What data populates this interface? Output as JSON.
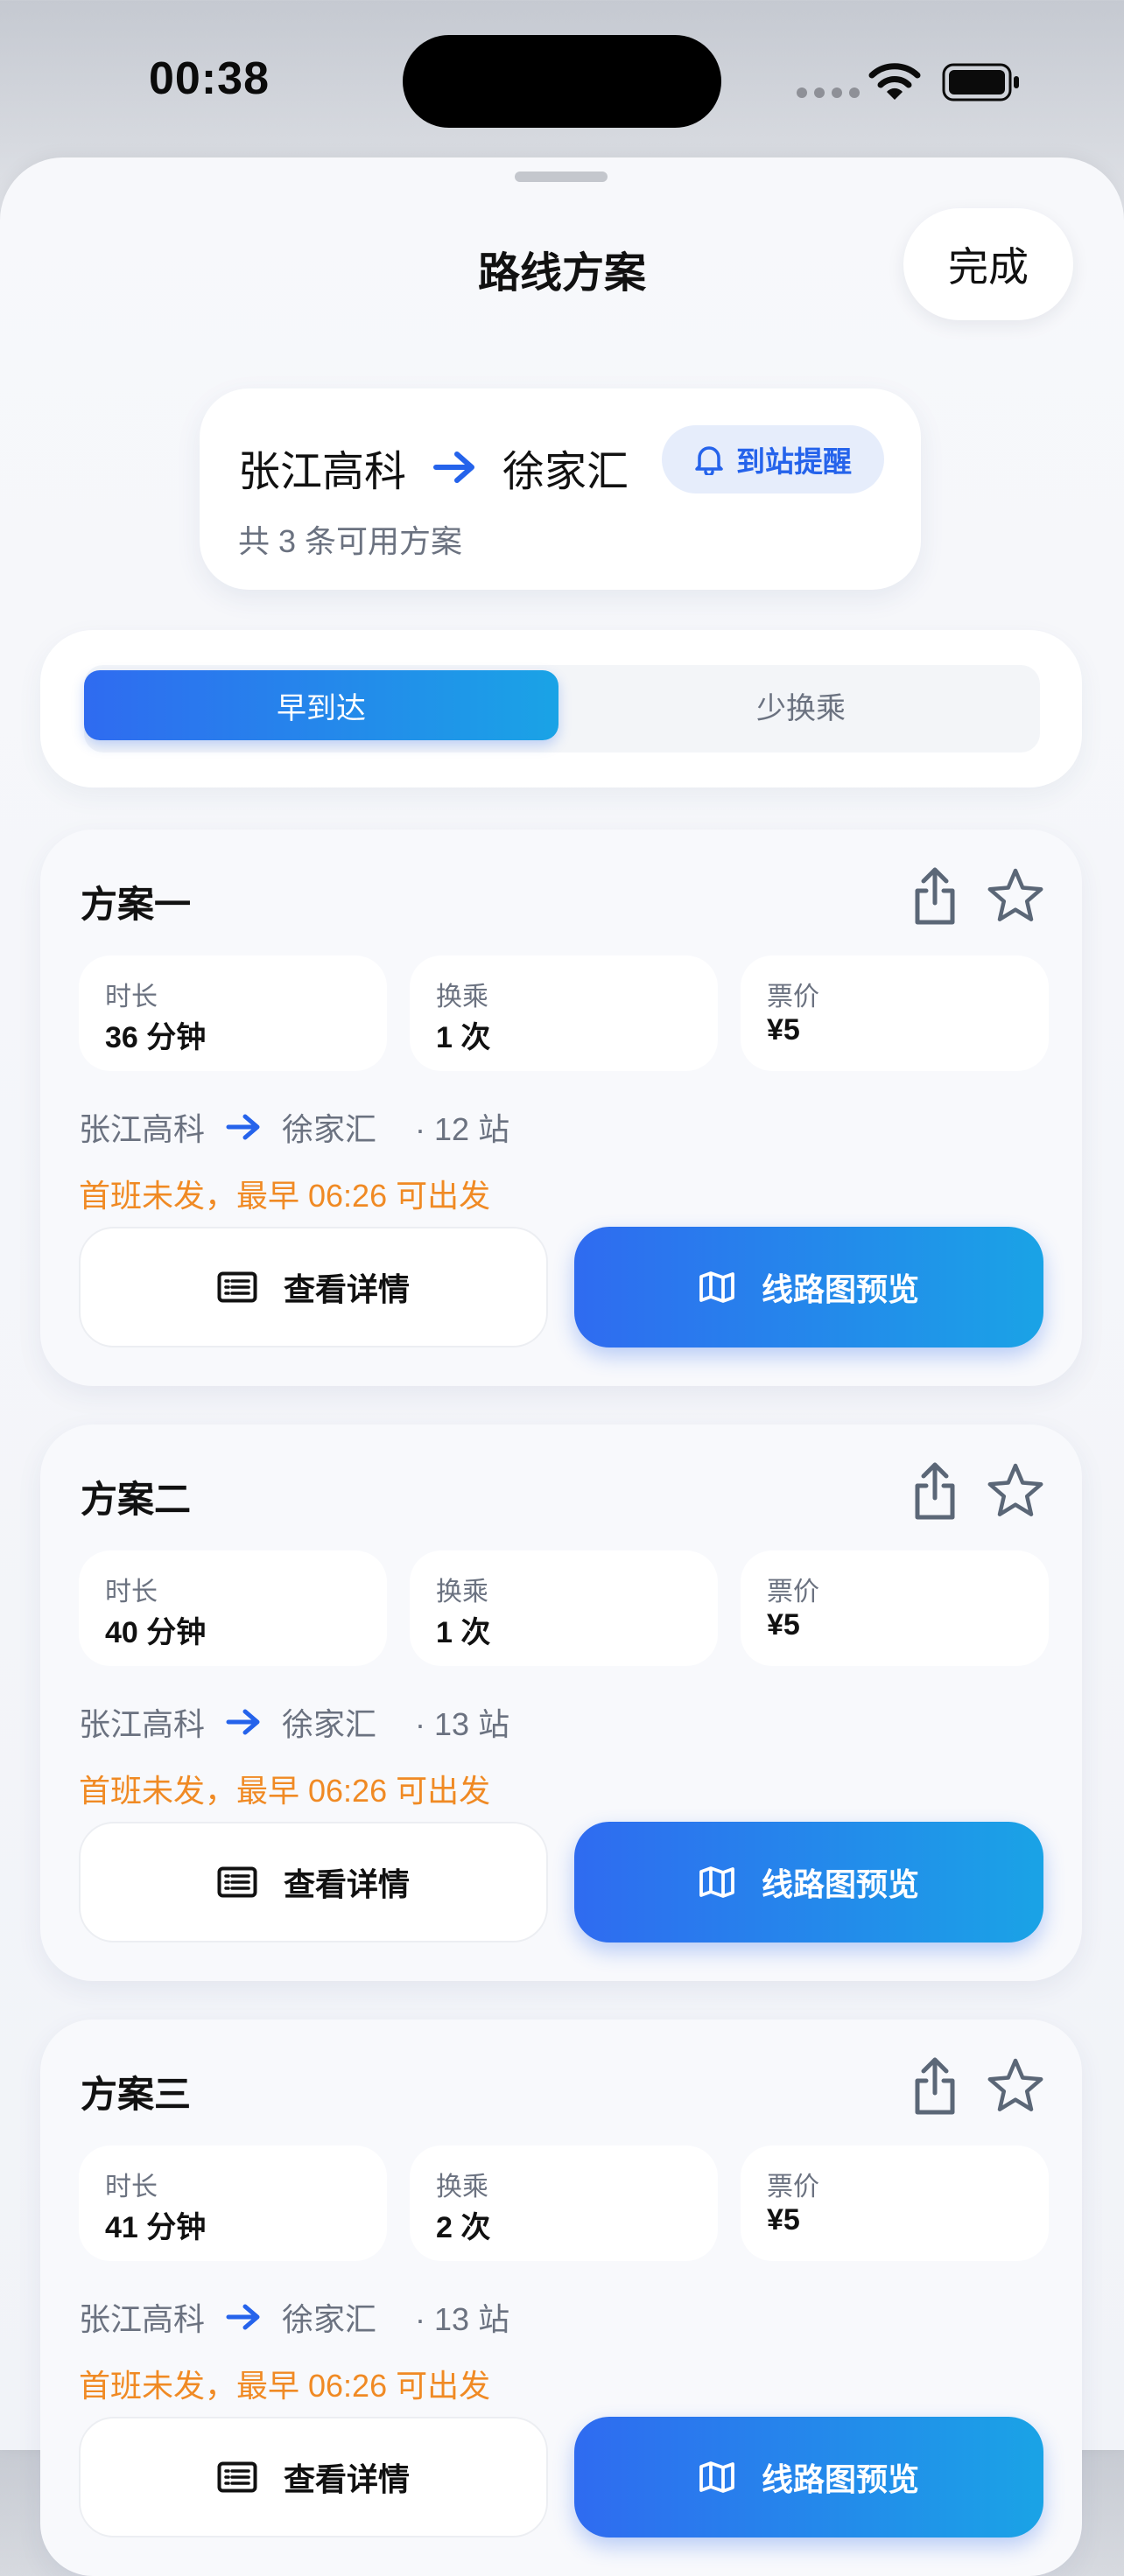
{
  "status_bar": {
    "time": "00:38"
  },
  "sheet": {
    "title": "路线方案",
    "done_label": "完成"
  },
  "route_summary": {
    "from": "张江高科",
    "to": "徐家汇",
    "reminder_label": "到站提醒",
    "subtitle": "共 3 条可用方案"
  },
  "segment": {
    "options": [
      "早到达",
      "少换乘"
    ],
    "selected": "早到达"
  },
  "plans": [
    {
      "title": "方案一",
      "stats": [
        {
          "label": "时长",
          "value": "36 分钟"
        },
        {
          "label": "换乘",
          "value": "1 次"
        },
        {
          "label": "票价",
          "value": "¥5"
        }
      ],
      "from": "张江高科",
      "to": "徐家汇",
      "stops": "· 12 站",
      "note": "首班未发，最早 06:26 可出发",
      "detail_label": "查看详情",
      "map_label": "线路图预览"
    },
    {
      "title": "方案二",
      "stats": [
        {
          "label": "时长",
          "value": "40 分钟"
        },
        {
          "label": "换乘",
          "value": "1 次"
        },
        {
          "label": "票价",
          "value": "¥5"
        }
      ],
      "from": "张江高科",
      "to": "徐家汇",
      "stops": "· 13 站",
      "note": "首班未发，最早 06:26 可出发",
      "detail_label": "查看详情",
      "map_label": "线路图预览"
    },
    {
      "title": "方案三",
      "stats": [
        {
          "label": "时长",
          "value": "41 分钟"
        },
        {
          "label": "换乘",
          "value": "2 次"
        },
        {
          "label": "票价",
          "value": "¥5"
        }
      ],
      "from": "张江高科",
      "to": "徐家汇",
      "stops": "· 13 站",
      "note": "首班未发，最早 06:26 可出发",
      "detail_label": "查看详情",
      "map_label": "线路图预览"
    }
  ],
  "icons": {
    "route_arrow": "arrow-right-icon",
    "reminder": "bell-icon",
    "share": "share-icon",
    "favorite": "star-icon",
    "detail": "list-icon",
    "map": "map-icon"
  },
  "colors": {
    "accent": "#2563eb",
    "accent_gradient_end": "#1aa3e6",
    "warning": "#f08a24",
    "muted_text": "#6b7280"
  }
}
